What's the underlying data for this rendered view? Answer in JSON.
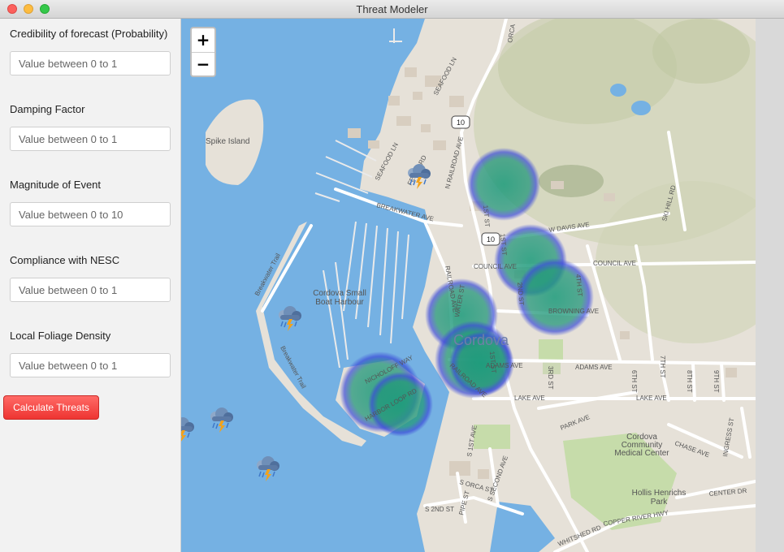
{
  "window": {
    "title": "Threat Modeler"
  },
  "form": {
    "fields": [
      {
        "label": "Credibility of forecast (Probability)",
        "placeholder": "Value between 0 to 1"
      },
      {
        "label": "Damping Factor",
        "placeholder": "Value between 0 to 1"
      },
      {
        "label": "Magnitude of Event",
        "placeholder": "Value between 0 to 10"
      },
      {
        "label": "Compliance with NESC",
        "placeholder": "Value between 0 to 1"
      },
      {
        "label": "Local Foliage Density",
        "placeholder": "Value between 0 to 1"
      }
    ],
    "calculate_label": "Calculate Threats",
    "accent_color": "#ef3a36"
  },
  "map": {
    "zoom_in": "+",
    "zoom_out": "−",
    "labels": {
      "spike_island": "Spike Island",
      "harbour_1": "Cordova Small",
      "harbour_2": "Boat Harbour",
      "cordova": "Cordova",
      "breakwater_trail_1": "Breakwater Trail",
      "breakwater_trail_2": "Breakwater Trail",
      "seafood_ln_1": "SEAFOOD LN",
      "seafood_ln_2": "SEAFOOD LN",
      "breakwater_ave": "BREAKWATER AVE",
      "n_railroad_ave": "N RAILROAD AVE",
      "railroad_ave": "RAILROAD AVE",
      "railroad_ave_2": "RAILROAD AVE",
      "first_st": "1ST ST",
      "first_st_2": "1ST ST",
      "w_davis_ave": "W DAVIS AVE",
      "council_ave": "COUNCIL AVE",
      "council_ave_2": "COUNCIL AVE",
      "browning_ave": "BROWNING AVE",
      "second_st": "2ND ST",
      "fourth_st": "4TH ST",
      "water_st": "WATER ST",
      "adams_ave": "ADAMS AVE",
      "adams_ave_2": "ADAMS AVE",
      "third_st": "3RD ST",
      "sixth_st": "6TH ST",
      "seventh_st": "7TH ST",
      "eighth_st": "8TH ST",
      "ninth_st": "9TH ST",
      "lake_ave": "LAKE AVE",
      "lake_ave_2": "LAKE AVE",
      "park_ave": "PARK AVE",
      "chase_ave": "CHASE AVE",
      "ingress_st": "INGRESS ST",
      "medical_1": "Cordova",
      "medical_2": "Community",
      "medical_3": "Medical Center",
      "hollis_1": "Hollis Henrichs",
      "hollis_2": "Park",
      "center_dr": "CENTER DR",
      "s_first_ave": "S 1ST AVE",
      "s_second_ave": "S SECOND AVE",
      "s_orca_st": "S ORCA ST",
      "s_2nd_st": "S 2ND ST",
      "pipe_st": "PIPE ST",
      "whitshed_rd": "WHITSHED RD",
      "copper_river_hwy": "COPPER RIVER HWY",
      "ski_hill_rd": "SKI HILL RD",
      "orca": "ORCA",
      "nicholoff_way": "NICHOLOFF WAY",
      "harbor_loop_rd": "HARBOR LOOP RD",
      "route_10": "10",
      "route_10b": "10",
      "first_st_3": "1ST ST",
      "ferry_rd": "FERRY RD"
    },
    "storm_icon": "storm-cloud-icon"
  }
}
